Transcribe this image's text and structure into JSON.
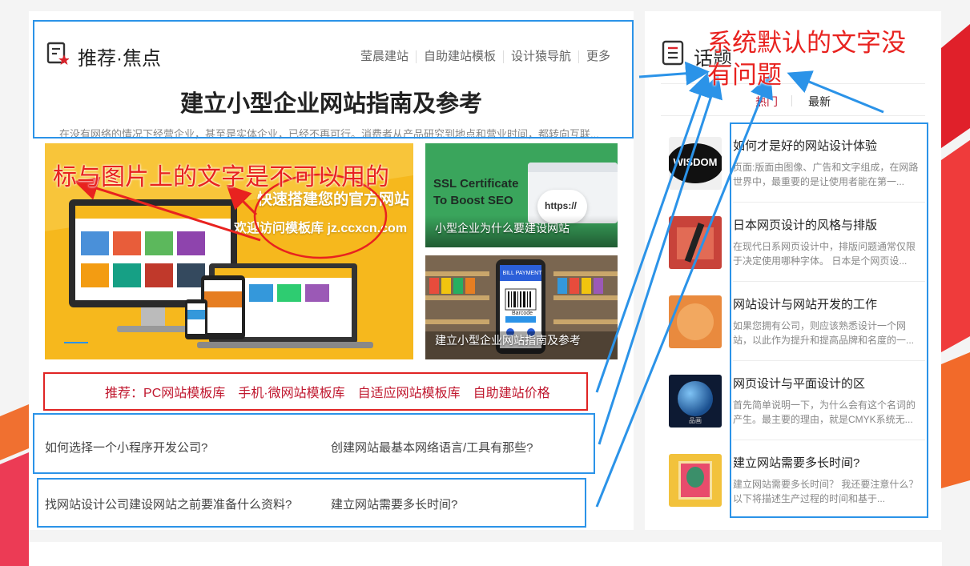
{
  "focus": {
    "section_title": "推荐·焦点",
    "nav": [
      "莹晨建站",
      "自助建站模板",
      "设计猿导航",
      "更多"
    ],
    "headline": "建立小型企业网站指南及参考",
    "summary": "在没有网络的情况下经营企业，甚至是实体企业，已经不再可行。消费者从产品研究到地点和营业时间，都转向互联...",
    "hero": {
      "line1": "快速搭建您的官方网站",
      "line2": "欢迎访问模板库 jz.ccxcn.com"
    },
    "side_cards": [
      {
        "caption": "小型企业为什么要建设网站",
        "art_line1": "SSL Certificate",
        "art_line2": "To Boost SEO",
        "art_tag": "https://"
      },
      {
        "caption": "建立小型企业网站指南及参考",
        "art_line1": "BILL PAYMENT",
        "art_line2": "Barcode"
      }
    ],
    "recommend": {
      "prefix": "推荐：",
      "links": [
        "PC网站模板库",
        "手机·微网站模板库",
        "自适应网站模板库",
        "自助建站价格"
      ]
    },
    "links_row1": [
      "如何选择一个小程序开发公司?",
      "创建网站最基本网络语言/工具有那些?"
    ],
    "links_row2": [
      "找网站设计公司建设网站之前要准备什么资料?",
      "建立网站需要多长时间?"
    ]
  },
  "topics": {
    "section_title": "话题",
    "tabs": [
      "热门",
      "最新"
    ],
    "items": [
      {
        "title": "如何才是好的网站设计体验",
        "desc": "页面:版面由图像、广告和文字组成，在网路世界中，最重要的是让使用者能在第一...",
        "thumb_text": "WISDOM"
      },
      {
        "title": "日本网页设计的风格与排版",
        "desc": "在现代日系网页设计中，排版问题通常仅限于决定使用哪种字体。 日本是个网页设...",
        "thumb_text": ""
      },
      {
        "title": "网站设计与网站开发的工作",
        "desc": "如果您拥有公司，则应该熟悉设计一个网站，以此作为提升和提高品牌和名度的一...",
        "thumb_text": ""
      },
      {
        "title": "网页设计与平面设计的区",
        "desc": "首先简单说明一下，为什么会有这个名词的产生。最主要的理由，就是CMYK系统无...",
        "thumb_text": "品画"
      },
      {
        "title": "建立网站需要多长时间?",
        "desc": "建立网站需要多长时间？ 我还要注意什么？ 以下将描述生产过程的时间和基于...",
        "thumb_text": ""
      }
    ]
  },
  "annotations": {
    "left_note": "标与图片上的文字是不可以用的",
    "right_note_line1": "系统默认的文字没",
    "right_note_line2": "有问题"
  },
  "colors": {
    "accent_red": "#c0182f",
    "annotation_red": "#e8221f",
    "annotation_blue": "#2b93e8",
    "hero_yellow": "#f6b81d",
    "ssl_green": "#3aa55c"
  }
}
